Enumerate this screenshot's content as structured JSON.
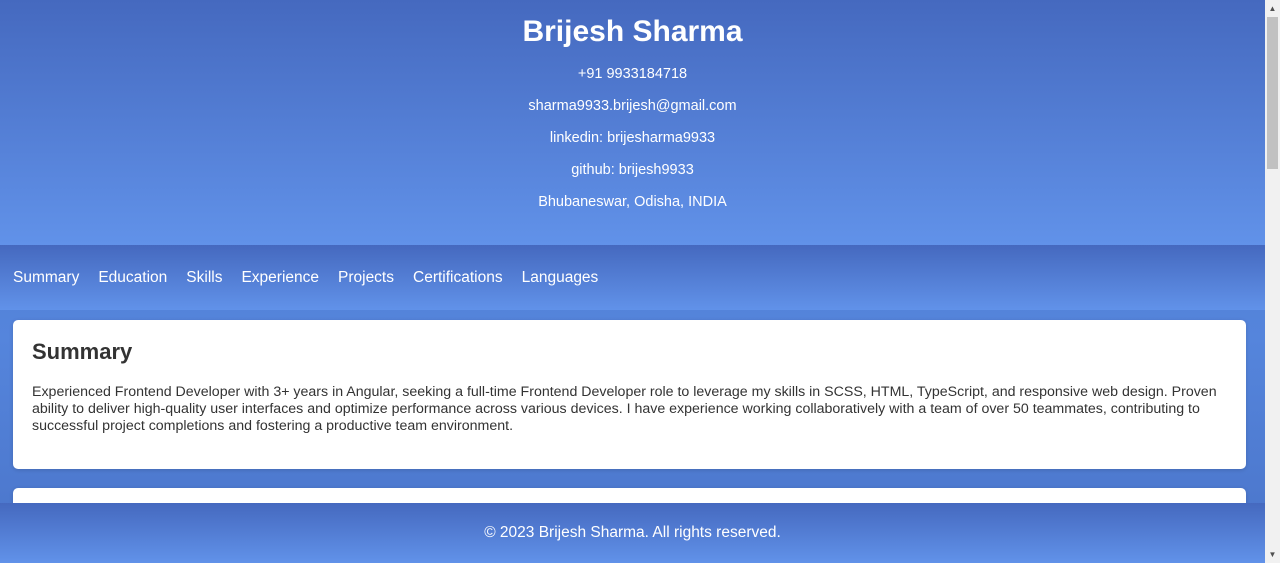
{
  "header": {
    "name": "Brijesh Sharma",
    "phone": "+91 9933184718",
    "email": "sharma9933.brijesh@gmail.com",
    "linkedin": "linkedin: brijesharma9933",
    "github": "github: brijesh9933",
    "location": "Bhubaneswar, Odisha, INDIA"
  },
  "nav": {
    "items": [
      {
        "label": "Summary"
      },
      {
        "label": "Education"
      },
      {
        "label": "Skills"
      },
      {
        "label": "Experience"
      },
      {
        "label": "Projects"
      },
      {
        "label": "Certifications"
      },
      {
        "label": "Languages"
      }
    ]
  },
  "summary": {
    "title": "Summary",
    "text": "Experienced Frontend Developer with 3+ years in Angular, seeking a full-time Frontend Developer role to leverage my skills in SCSS, HTML, TypeScript, and responsive web design. Proven ability to deliver high-quality user interfaces and optimize performance across various devices. I have experience working collaboratively with a team of over 50 teammates, contributing to successful project completions and fostering a productive team environment."
  },
  "footer": {
    "text": "© 2023 Brijesh Sharma. All rights reserved."
  },
  "scrollbar": {
    "up_icon": "scroll-up-arrow-icon",
    "down_icon": "scroll-down-arrow-icon"
  }
}
